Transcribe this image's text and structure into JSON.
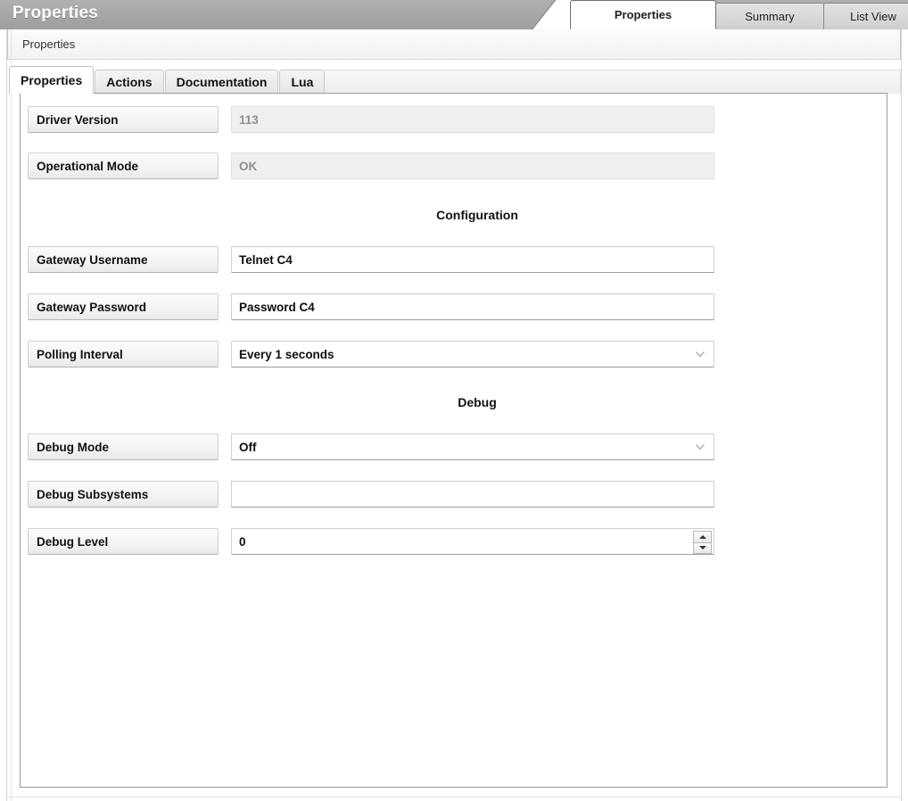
{
  "window": {
    "title": "Properties"
  },
  "top_tabs": [
    {
      "label": "Properties",
      "active": true
    },
    {
      "label": "Summary",
      "active": false
    },
    {
      "label": "List View",
      "active": false
    }
  ],
  "breadcrumb": {
    "label": "Properties"
  },
  "inner_tabs": [
    {
      "label": "Properties",
      "active": true
    },
    {
      "label": "Actions",
      "active": false
    },
    {
      "label": "Documentation",
      "active": false
    },
    {
      "label": "Lua",
      "active": false
    }
  ],
  "form": {
    "driver_version": {
      "label": "Driver Version",
      "value": "113"
    },
    "operational_mode": {
      "label": "Operational Mode",
      "value": "OK"
    },
    "configuration_header": "Configuration",
    "gateway_username": {
      "label": "Gateway Username",
      "value": "Telnet C4"
    },
    "gateway_password": {
      "label": "Gateway Password",
      "value": "Password C4"
    },
    "polling_interval": {
      "label": "Polling Interval",
      "value": "Every 1 seconds"
    },
    "debug_header": "Debug",
    "debug_mode": {
      "label": "Debug Mode",
      "value": "Off"
    },
    "debug_subsystems": {
      "label": "Debug Subsystems",
      "value": ""
    },
    "debug_level": {
      "label": "Debug Level",
      "value": "0"
    }
  },
  "icons": {
    "chevron_down": "chevron-down-icon",
    "spinner_up": "spinner-up-icon",
    "spinner_down": "spinner-down-icon"
  },
  "colors": {
    "titlebar": "#a6a6a6",
    "panel_border": "#9a9a9a",
    "readonly_bg": "#efefef",
    "readonly_text": "#8e8e8e",
    "label_bg": "#f2f2f2"
  }
}
